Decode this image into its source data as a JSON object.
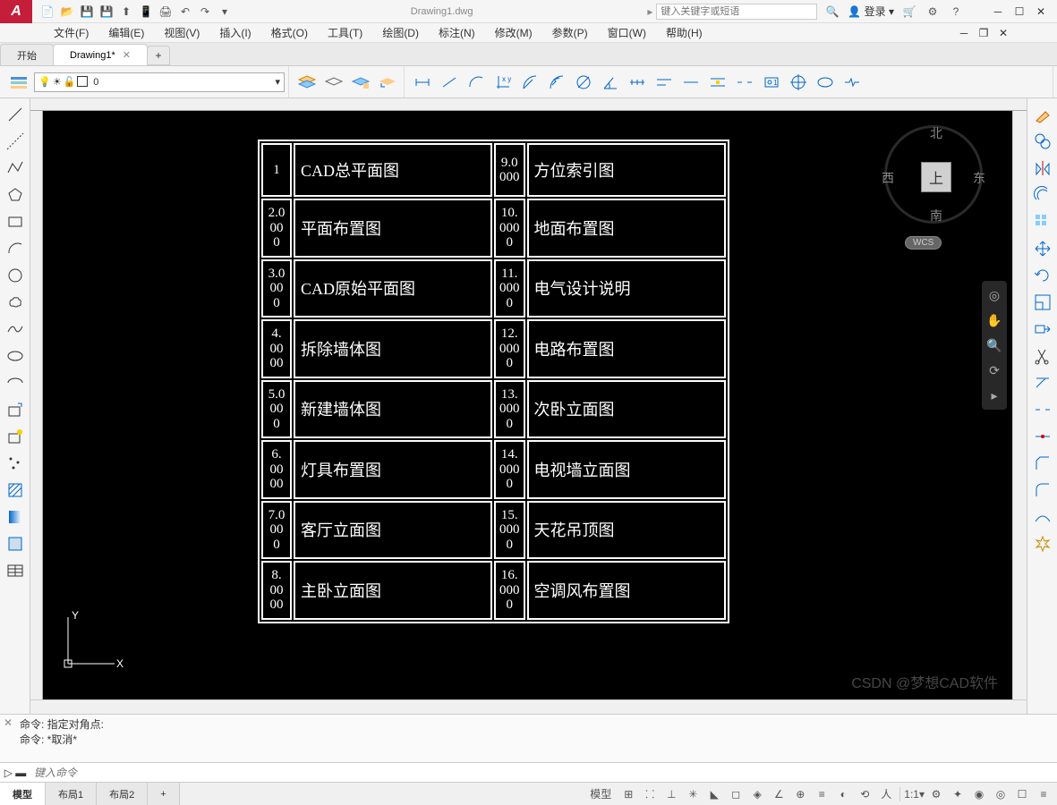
{
  "title": "Drawing1.dwg",
  "search_placeholder": "键入关键字或短语",
  "login": "登录",
  "menus": [
    "文件(F)",
    "编辑(E)",
    "视图(V)",
    "插入(I)",
    "格式(O)",
    "工具(T)",
    "绘图(D)",
    "标注(N)",
    "修改(M)",
    "参数(P)",
    "窗口(W)",
    "帮助(H)"
  ],
  "tabs": {
    "start": "开始",
    "drawing": "Drawing1*"
  },
  "layer_name": "0",
  "table": {
    "rows": [
      {
        "n1": "1",
        "d1": "CAD总平面图",
        "n2": "9.0\n000",
        "d2": "方位索引图"
      },
      {
        "n1": "2.0\n00\n0",
        "d1": "平面布置图",
        "n2": "10.\n000\n0",
        "d2": "地面布置图"
      },
      {
        "n1": "3.0\n00\n0",
        "d1": "CAD原始平面图",
        "n2": "11.\n000\n0",
        "d2": "电气设计说明"
      },
      {
        "n1": "4.\n00\n00",
        "d1": "拆除墙体图",
        "n2": "12.\n000\n0",
        "d2": "电路布置图"
      },
      {
        "n1": "5.0\n00\n0",
        "d1": "新建墙体图",
        "n2": "13.\n000\n0",
        "d2": "次卧立面图"
      },
      {
        "n1": "6.\n00\n00",
        "d1": "灯具布置图",
        "n2": "14.\n000\n0",
        "d2": "电视墙立面图"
      },
      {
        "n1": "7.0\n00\n0",
        "d1": "客厅立面图",
        "n2": "15.\n000\n0",
        "d2": "天花吊顶图"
      },
      {
        "n1": "8.\n00\n00",
        "d1": "主卧立面图",
        "n2": "16.\n000\n0",
        "d2": "空调风布置图"
      }
    ]
  },
  "viewcube": {
    "center": "上",
    "n": "北",
    "s": "南",
    "e": "东",
    "w": "西",
    "wcs": "WCS"
  },
  "cmd": {
    "line1": "命令: 指定对角点:",
    "line2": "命令: *取消*",
    "placeholder": "键入命令"
  },
  "status_tabs": [
    "模型",
    "布局1",
    "布局2"
  ],
  "status_model_label": "模型",
  "scale": "1:1",
  "watermark": "CSDN @梦想CAD软件"
}
